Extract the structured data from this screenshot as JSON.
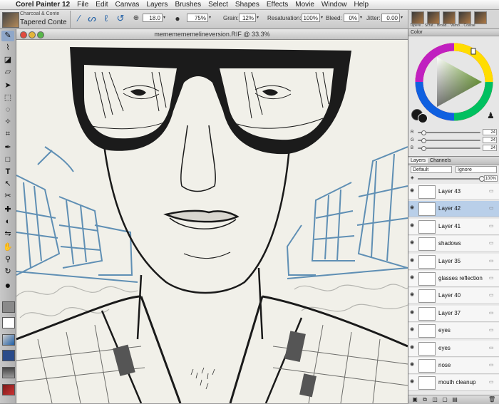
{
  "menubar": {
    "app_name": "Corel Painter 12",
    "items": [
      "File",
      "Edit",
      "Canvas",
      "Layers",
      "Brushes",
      "Select",
      "Shapes",
      "Effects",
      "Movie",
      "Window",
      "Help"
    ]
  },
  "property_bar": {
    "brush_category": "Charcoal & Conte",
    "brush_variant": "Tapered Conte",
    "size_value": "18.0",
    "opacity_value": "75%",
    "grain_label": "Grain:",
    "grain_value": "12%",
    "resaturation_label": "Resaturation:",
    "resaturation_value": "100%",
    "bleed_label": "Bleed:",
    "bleed_value": "0%",
    "jitter_label": "Jitter:",
    "jitter_value": "0.00"
  },
  "brush_library": {
    "label": "Tapere... Scrat... Broad... Varno... Coarse"
  },
  "document": {
    "title": "mememememelineversion.RIF @ 33.3%"
  },
  "color_panel": {
    "title": "Color",
    "sliders": [
      {
        "label": "R",
        "value": "24",
        "fraction": 0.09
      },
      {
        "label": "G",
        "value": "24",
        "fraction": 0.09
      },
      {
        "label": "B",
        "value": "24",
        "fraction": 0.09
      }
    ]
  },
  "layers_panel": {
    "tabs": [
      "Layers",
      "Channels"
    ],
    "composite_method": "Default",
    "preserve_mode": "Ignore",
    "opacity": "100%",
    "layers": [
      {
        "name": "Layer 43",
        "selected": false
      },
      {
        "name": "Layer 42",
        "selected": true
      },
      {
        "name": "Layer 41",
        "selected": false
      },
      {
        "name": "shadows",
        "selected": false
      },
      {
        "name": "Layer 35",
        "selected": false
      },
      {
        "name": "glasses reflection",
        "selected": false
      },
      {
        "name": "Layer 40",
        "selected": false
      },
      {
        "name": "Layer 37",
        "selected": false
      },
      {
        "name": "eyes",
        "selected": false
      },
      {
        "name": "eyes",
        "selected": false
      },
      {
        "name": "nose",
        "selected": false
      },
      {
        "name": "mouth cleanup",
        "selected": false
      }
    ]
  },
  "colors": {
    "accent": "#1f5fa6",
    "selected_row": "#b9cfe9",
    "sketch_blue": "#5f8fb4",
    "canvas_paper": "#f1f0e9"
  }
}
